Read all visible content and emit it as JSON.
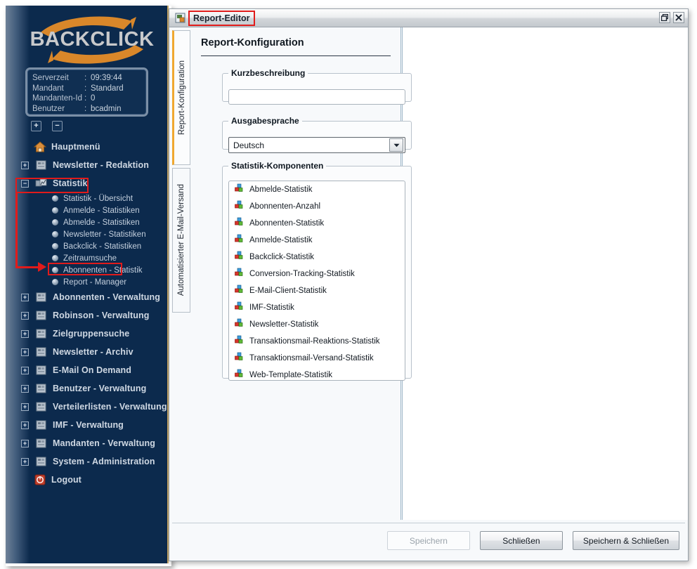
{
  "brand": {
    "logo_text": "BACKCLICK",
    "logo_color": "#c8c9cb",
    "swoosh_color": "#d9872a",
    "sidebar_bg": "#0c2a4d",
    "accent_orange": "#f0a830",
    "annotation_red": "#e01b1b"
  },
  "info_panel": {
    "rows": [
      {
        "key": "Serverzeit",
        "sep": ":",
        "value": "09:39:44"
      },
      {
        "key": "Mandant",
        "sep": ":",
        "value": "Standard"
      },
      {
        "key": "Mandanten-Id",
        "sep": ":",
        "value": "0"
      },
      {
        "key": "Benutzer",
        "sep": ":",
        "value": "bcadmin"
      }
    ]
  },
  "tree_controls": {
    "expand_all": "+",
    "collapse_all": "−"
  },
  "sidebar": {
    "items": [
      {
        "label": "Hauptmenü",
        "icon": "home-icon",
        "toggle": "none"
      },
      {
        "label": "Newsletter - Redaktion",
        "icon": "folder-icon",
        "toggle": "+"
      },
      {
        "label": "Statistik",
        "icon": "statistics-icon",
        "toggle": "−",
        "highlighted": true
      }
    ],
    "statistik_children": [
      {
        "label": "Statistik - Übersicht"
      },
      {
        "label": "Anmelde - Statistiken"
      },
      {
        "label": "Abmelde - Statistiken"
      },
      {
        "label": "Newsletter - Statistiken"
      },
      {
        "label": "Backclick - Statistiken"
      },
      {
        "label": "Zeitraumsuche"
      },
      {
        "label": "Abonnenten - Statistik"
      },
      {
        "label": "Report - Manager",
        "highlighted": true
      }
    ],
    "items_after": [
      {
        "label": "Abonnenten - Verwaltung",
        "icon": "folder-icon",
        "toggle": "+"
      },
      {
        "label": "Robinson - Verwaltung",
        "icon": "folder-icon",
        "toggle": "+"
      },
      {
        "label": "Zielgruppensuche",
        "icon": "folder-icon",
        "toggle": "+"
      },
      {
        "label": "Newsletter - Archiv",
        "icon": "folder-icon",
        "toggle": "+"
      },
      {
        "label": "E-Mail On Demand",
        "icon": "folder-icon",
        "toggle": "+"
      },
      {
        "label": "Benutzer - Verwaltung",
        "icon": "folder-icon",
        "toggle": "+"
      },
      {
        "label": "Verteilerlisten - Verwaltung",
        "icon": "folder-icon",
        "toggle": "+"
      },
      {
        "label": "IMF - Verwaltung",
        "icon": "folder-icon",
        "toggle": "+"
      },
      {
        "label": "Mandanten - Verwaltung",
        "icon": "folder-icon",
        "toggle": "+"
      },
      {
        "label": "System - Administration",
        "icon": "folder-icon",
        "toggle": "+"
      },
      {
        "label": "Logout",
        "icon": "power-icon",
        "toggle": "none"
      }
    ]
  },
  "window": {
    "title": "Report-Editor",
    "title_icon": "report-window-icon",
    "restore_button": "restore-icon",
    "close_button": "close-icon"
  },
  "tabs": [
    {
      "label": "Report-Konfiguration",
      "active": true
    },
    {
      "label": "Automatisierter E-Mail-Versand",
      "active": false
    }
  ],
  "form": {
    "heading": "Report-Konfiguration",
    "kurzbeschreibung": {
      "legend": "Kurzbeschreibung",
      "value": "",
      "placeholder": ""
    },
    "ausgabesprache": {
      "legend": "Ausgabesprache",
      "selected": "Deutsch",
      "arrow_icon": "chevron-down-icon"
    },
    "statistik_komponenten": {
      "legend": "Statistik-Komponenten",
      "items": [
        "Abmelde-Statistik",
        "Abonnenten-Anzahl",
        "Abonnenten-Statistik",
        "Anmelde-Statistik",
        "Backclick-Statistik",
        "Conversion-Tracking-Statistik",
        "E-Mail-Client-Statistik",
        "IMF-Statistik",
        "Newsletter-Statistik",
        "Transaktionsmail-Reaktions-Statistik",
        "Transaktionsmail-Versand-Statistik",
        "Web-Template-Statistik"
      ],
      "item_icon": "bar-chart-icon"
    }
  },
  "footer": {
    "save_label": "Speichern",
    "save_disabled": true,
    "close_label": "Schließen",
    "save_and_close_label": "Speichern & Schließen"
  }
}
